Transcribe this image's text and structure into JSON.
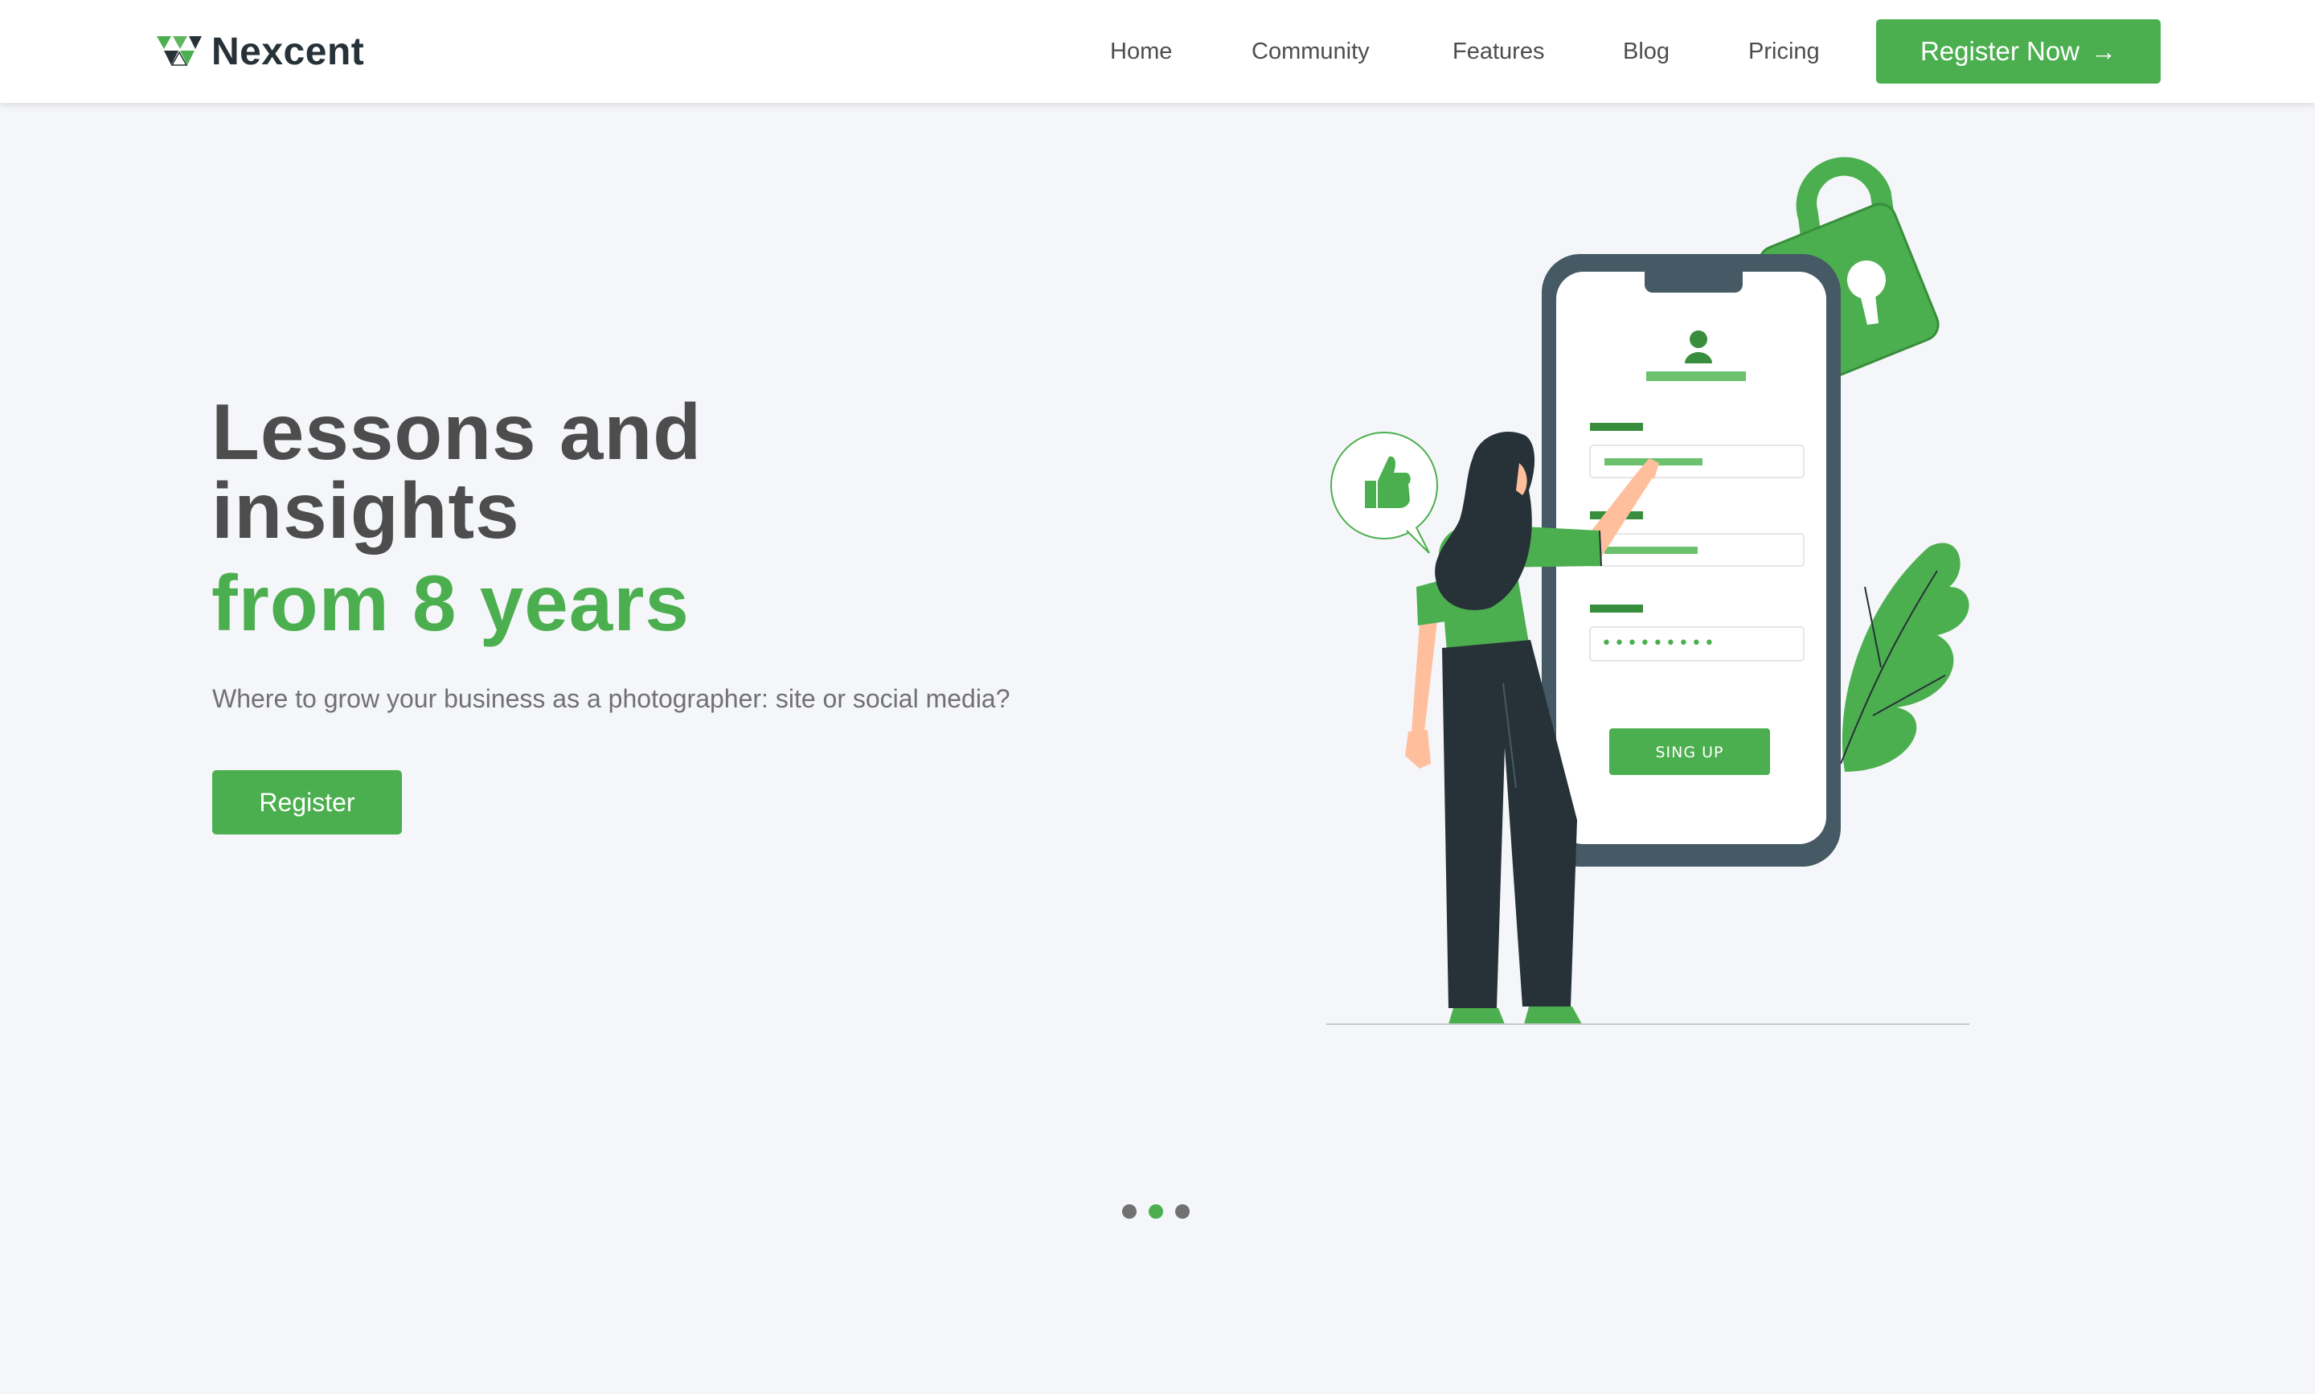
{
  "brand": {
    "name": "Nexcent",
    "icon": "nexcent-logo-icon",
    "primary_color": "#4caf4f",
    "dark_color": "#263238"
  },
  "nav": {
    "items": [
      {
        "label": "Home"
      },
      {
        "label": "Community"
      },
      {
        "label": "Features"
      },
      {
        "label": "Blog"
      },
      {
        "label": "Pricing"
      }
    ],
    "cta_label": "Register Now",
    "cta_icon": "arrow-right-icon"
  },
  "hero": {
    "title": "Lessons and insights",
    "title_accent": "from 8 years",
    "subtitle": "Where to grow your business as a photographer: site or social media?",
    "button_label": "Register"
  },
  "illustration": {
    "phone_button_label": "SING UP",
    "password_mask": "•••••••••"
  },
  "slider": {
    "dot_count": 3,
    "active_index": 1
  }
}
